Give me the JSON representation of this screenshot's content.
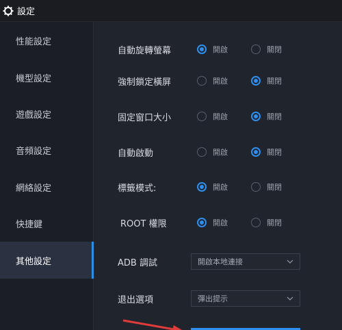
{
  "window": {
    "title": "設定"
  },
  "sidebar": {
    "items": [
      {
        "label": "性能設定"
      },
      {
        "label": "機型設定"
      },
      {
        "label": "遊戲設定"
      },
      {
        "label": "音頻設定"
      },
      {
        "label": "網絡設定"
      },
      {
        "label": "快捷鍵"
      },
      {
        "label": "其他設定",
        "active": true
      }
    ]
  },
  "options": {
    "open_label": "開啟",
    "close_label": "關閉",
    "rows": [
      {
        "label": "自動旋轉螢幕",
        "value": "open"
      },
      {
        "label": "強制鎖定橫屏",
        "value": "close"
      },
      {
        "label": "固定窗口大小",
        "value": "close"
      },
      {
        "label": "自動啟動",
        "value": "close"
      },
      {
        "label": "標籤模式:",
        "value": "open"
      },
      {
        "label": "ROOT 權限",
        "value": "open"
      }
    ]
  },
  "adb": {
    "label": "ADB 調試",
    "value": "開啟本地連接"
  },
  "exit": {
    "label": "退出選項",
    "value": "彈出提示"
  },
  "colors": {
    "accent": "#2f8ff0",
    "arrow": "#e03b3b"
  }
}
